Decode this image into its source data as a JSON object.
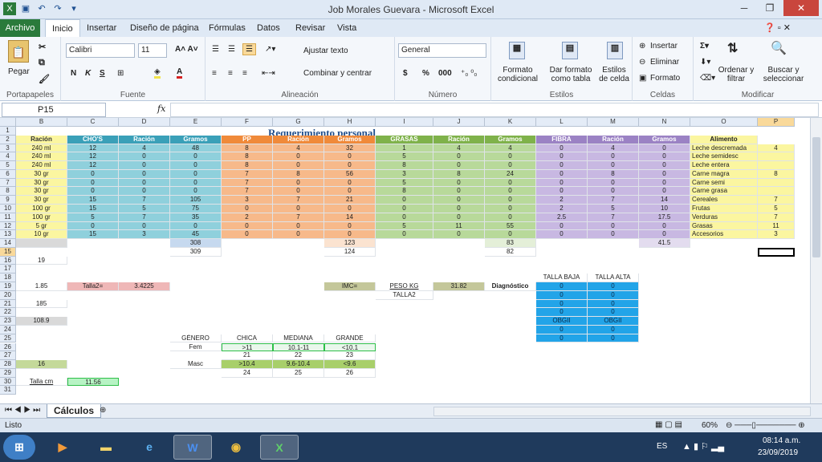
{
  "window": {
    "title": "Job Morales Guevara - Microsoft Excel"
  },
  "tabs": [
    "Archivo",
    "Inicio",
    "Insertar",
    "Diseño de página",
    "Fórmulas",
    "Datos",
    "Revisar",
    "Vista"
  ],
  "ribbon": {
    "portapapeles": {
      "label": "Portapapeles",
      "paste": "Pegar"
    },
    "fuente": {
      "label": "Fuente",
      "font": "Calibri",
      "size": "11",
      "bold": "N",
      "italic": "K",
      "underline": "S"
    },
    "alineacion": {
      "label": "Alineación",
      "wrap": "Ajustar texto",
      "merge": "Combinar y centrar"
    },
    "numero": {
      "label": "Número",
      "format": "General",
      "currency": "$",
      "percent": "%",
      "thousands": "000"
    },
    "estilos": {
      "label": "Estilos",
      "cond": "Formato condicional",
      "table": "Dar formato como tabla",
      "cell": "Estilos de celda"
    },
    "celdas": {
      "label": "Celdas",
      "insert": "Insertar",
      "delete": "Eliminar",
      "format": "Formato"
    },
    "modificar": {
      "label": "Modificar",
      "sort": "Ordenar y filtrar",
      "find": "Buscar y seleccionar"
    }
  },
  "formula_bar": {
    "name_box": "P15",
    "fx": "fx",
    "content": ""
  },
  "columns": [
    "B",
    "C",
    "D",
    "E",
    "F",
    "G",
    "H",
    "I",
    "J",
    "K",
    "L",
    "M",
    "N",
    "O",
    "P"
  ],
  "rows": [
    "1",
    "2",
    "3",
    "4",
    "5",
    "6",
    "7",
    "8",
    "9",
    "10",
    "11",
    "12",
    "13",
    "14",
    "15",
    "16",
    "17",
    "18",
    "19",
    "20",
    "21",
    "22",
    "23",
    "24",
    "25",
    "26",
    "27",
    "28",
    "29",
    "30",
    "31"
  ],
  "sheet": {
    "title": "Requerimiento personal",
    "headers": {
      "b": "Ración",
      "c": "CHO'S",
      "d": "Ración",
      "e": "Gramos",
      "f": "PP",
      "g": "Ración",
      "h": "Gramos",
      "i": "GRASAS",
      "j": "Ración",
      "k": "Gramos",
      "l": "FIBRA",
      "m": "Ración",
      "n": "Gramos",
      "o": "Alimento"
    },
    "table": [
      [
        "240 ml",
        "12",
        "4",
        "48",
        "8",
        "4",
        "32",
        "1",
        "4",
        "4",
        "0",
        "4",
        "0",
        "Leche descremada",
        "4"
      ],
      [
        "240 ml",
        "12",
        "0",
        "0",
        "8",
        "0",
        "0",
        "5",
        "0",
        "0",
        "0",
        "0",
        "0",
        "Leche semidesc",
        ""
      ],
      [
        "240 ml",
        "12",
        "0",
        "0",
        "8",
        "0",
        "0",
        "8",
        "0",
        "0",
        "0",
        "0",
        "0",
        "Leche entera",
        ""
      ],
      [
        "30 gr",
        "0",
        "0",
        "0",
        "7",
        "8",
        "56",
        "3",
        "8",
        "24",
        "0",
        "8",
        "0",
        "Carne magra",
        "8"
      ],
      [
        "30 gr",
        "0",
        "0",
        "0",
        "7",
        "0",
        "0",
        "5",
        "0",
        "0",
        "0",
        "0",
        "0",
        "Carne semi",
        ""
      ],
      [
        "30 gr",
        "0",
        "0",
        "0",
        "7",
        "0",
        "0",
        "8",
        "0",
        "0",
        "0",
        "0",
        "0",
        "Carne grasa",
        ""
      ],
      [
        "30 gr",
        "15",
        "7",
        "105",
        "3",
        "7",
        "21",
        "0",
        "0",
        "0",
        "2",
        "7",
        "14",
        "Cereales",
        "7"
      ],
      [
        "100 gr",
        "15",
        "5",
        "75",
        "0",
        "0",
        "0",
        "0",
        "0",
        "0",
        "2",
        "5",
        "10",
        "Frutas",
        "5"
      ],
      [
        "100 gr",
        "5",
        "7",
        "35",
        "2",
        "7",
        "14",
        "0",
        "0",
        "0",
        "2.5",
        "7",
        "17.5",
        "Verduras",
        "7"
      ],
      [
        "5 gr",
        "0",
        "0",
        "0",
        "0",
        "0",
        "0",
        "5",
        "11",
        "55",
        "0",
        "0",
        "0",
        "Grasas",
        "11"
      ],
      [
        "10 gr",
        "15",
        "3",
        "45",
        "0",
        "0",
        "0",
        "0",
        "0",
        "0",
        "0",
        "0",
        "0",
        "Accesorios",
        "3"
      ]
    ],
    "totals": {
      "e14": "308",
      "e15": "309",
      "h14": "123",
      "h15": "124",
      "k14": "83",
      "k15": "82",
      "n14": "41.5"
    },
    "b16": "19",
    "b19": "1.85",
    "talla2_label": "Talla2=",
    "talla2_value": "3.4225",
    "imc_label": "IMC=",
    "peso_label": "PESO KG",
    "peso_value": "31.82",
    "talla2_text": "TALLA2",
    "diagnostico": "Diagnóstico",
    "b21": "185",
    "b23": "108.9",
    "talla_baja": "TALLA BAJA",
    "talla_alta": "TALLA ALTA",
    "blue": [
      [
        "0",
        "0"
      ],
      [
        "0",
        "0"
      ],
      [
        "0",
        "0"
      ],
      [
        "0",
        "0"
      ],
      [
        "OBGII",
        "OBGII"
      ],
      [
        "0",
        "0"
      ],
      [
        "0",
        "0"
      ]
    ],
    "genero": "GÉNERO",
    "chica": "CHICA",
    "mediana": "MEDIANA",
    "grande": "GRANDE",
    "fem": "Fem",
    "fem_vals": [
      ">11",
      "10.1-11",
      "<10.1"
    ],
    "fem_nums": [
      "21",
      "22",
      "23"
    ],
    "masc": "Masc",
    "masc_vals": [
      ">10.4",
      "9.6-10.4",
      "<9.6"
    ],
    "masc_nums": [
      "24",
      "25",
      "26"
    ],
    "b28": "16",
    "talla_cm": "Talla cm",
    "c30": "11.56"
  },
  "sheet_tab": "Cálculos",
  "status": {
    "ready": "Listo",
    "zoom": "60%"
  },
  "tray": {
    "lang": "ES",
    "time": "08:14 a.m.",
    "date": "23/09/2019"
  },
  "colors": {
    "file_tab": "#2a7a3b",
    "cho": "#3aa0b8",
    "cho_fill": "#8fd0dc",
    "pp": "#f08a3a",
    "pp_fill": "#f7b98a",
    "grasas": "#7fb24a",
    "grasas_fill": "#b8d99a",
    "fibra": "#9b82c4",
    "fibra_fill": "#c8b8e2",
    "alimento": "#fbf6a0",
    "blue_block": "#22a4e8"
  }
}
